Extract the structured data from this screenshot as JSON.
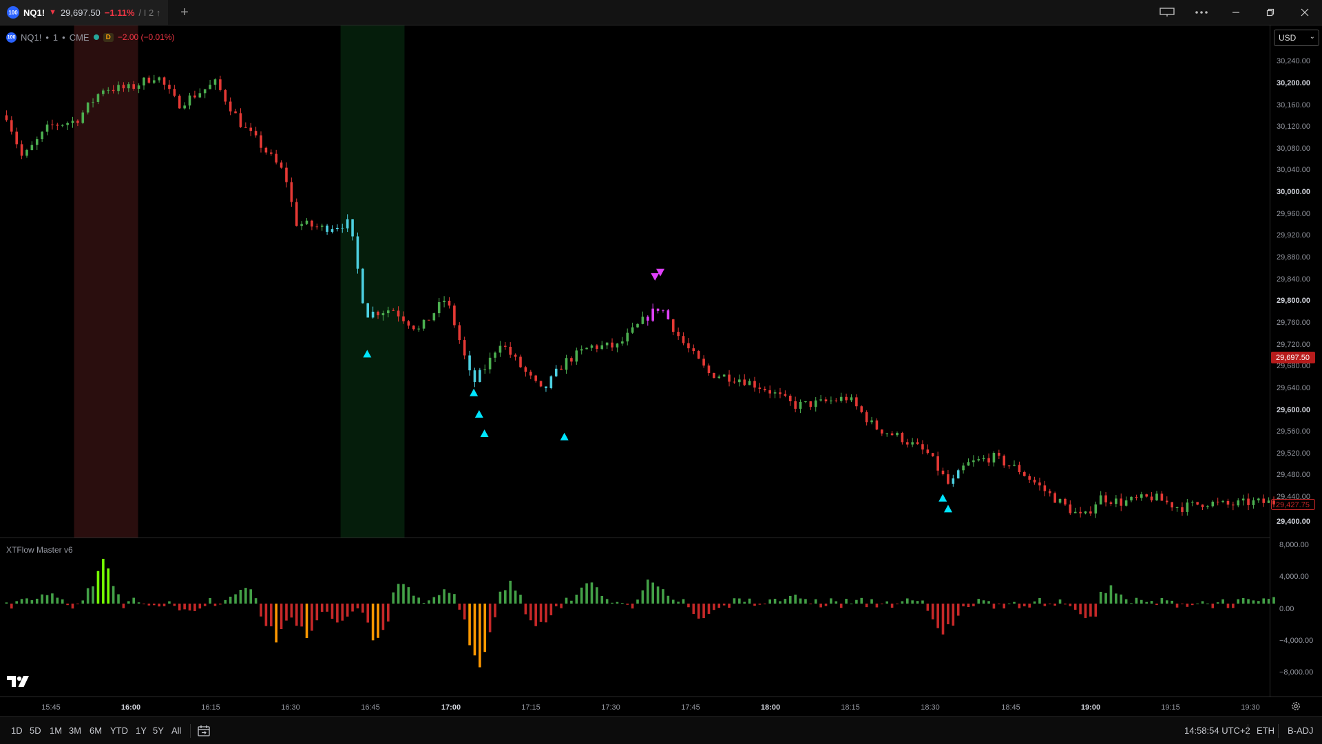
{
  "window": {
    "tab": {
      "badge": "100",
      "symbol": "NQ1!",
      "arrow": "▼",
      "price": "29,697.50",
      "change_pct": "−1.11%",
      "suffix": "/ I 2 ↑"
    },
    "new_tab": "+",
    "controls": [
      "layout-icon",
      "more-icon",
      "minimize-icon",
      "restore-icon",
      "close-icon"
    ]
  },
  "legend": {
    "badge": "100",
    "symbol": "NQ1!",
    "interval": "1",
    "exchange": "CME",
    "session_badge": "D",
    "change": "−2.00 (−0.01%)"
  },
  "currency": "USD",
  "price_axis": {
    "labels": [
      "30,240.00",
      "30,200.00",
      "30,160.00",
      "30,120.00",
      "30,080.00",
      "30,040.00",
      "30,000.00",
      "29,960.00",
      "29,920.00",
      "29,880.00",
      "29,840.00",
      "29,800.00",
      "29,760.00",
      "29,720.00",
      "29,680.00",
      "29,640.00",
      "29,600.00",
      "29,560.00",
      "29,520.00",
      "29,480.00",
      "29,440.00",
      "29,400.00"
    ],
    "last_price": "29,697.50",
    "ghost_price": "29,427.75"
  },
  "indicator": {
    "name": "XTFlow Master v6",
    "axis_labels": [
      "8,000.00",
      "4,000.00",
      "0.00",
      "−4,000.00",
      "−8,000.00"
    ]
  },
  "time_axis": {
    "labels": [
      "15:45",
      "16:00",
      "16:15",
      "16:30",
      "16:45",
      "17:00",
      "17:15",
      "17:30",
      "17:45",
      "18:00",
      "18:15",
      "18:30",
      "18:45",
      "19:00",
      "19:15",
      "19:30"
    ]
  },
  "bottom_bar": {
    "ranges": [
      "1D",
      "5D",
      "1M",
      "3M",
      "6M",
      "YTD",
      "1Y",
      "5Y",
      "All"
    ],
    "clock": "14:58:54 UTC+2",
    "session": "ETH",
    "adjust": "B-ADJ"
  },
  "colors": {
    "up": "#4caf50",
    "down": "#e53935",
    "neutral": "#4dd0e1",
    "signal": "#e040fb",
    "hist_up": "#43a047",
    "hist_up_strong": "#76ff03",
    "hist_down": "#c62828",
    "hist_down_strong": "#ff9800",
    "last_price_tag": "#b71c1c"
  },
  "chart_data": {
    "type": "candlestick",
    "title": "",
    "xlabel": "",
    "ylabel": "",
    "ylim": [
      29380,
      30280
    ],
    "time_range": [
      "15:38",
      "19:40"
    ],
    "bars": 250,
    "anchors": [
      {
        "t": "15:38",
        "p": 30160
      },
      {
        "t": "15:41",
        "p": 30080
      },
      {
        "t": "15:46",
        "p": 30140
      },
      {
        "t": "15:51",
        "p": 30150
      },
      {
        "t": "15:56",
        "p": 30210
      },
      {
        "t": "16:01",
        "p": 30210
      },
      {
        "t": "16:06",
        "p": 30235
      },
      {
        "t": "16:10",
        "p": 30180
      },
      {
        "t": "16:17",
        "p": 30220
      },
      {
        "t": "16:22",
        "p": 30140
      },
      {
        "t": "16:25",
        "p": 30110
      },
      {
        "t": "16:30",
        "p": 30050
      },
      {
        "t": "16:32",
        "p": 29960
      },
      {
        "t": "16:37",
        "p": 29950
      },
      {
        "t": "16:42",
        "p": 29960
      },
      {
        "t": "16:45",
        "p": 29790
      },
      {
        "t": "16:50",
        "p": 29800
      },
      {
        "t": "16:55",
        "p": 29760
      },
      {
        "t": "17:00",
        "p": 29820
      },
      {
        "t": "17:02",
        "p": 29760
      },
      {
        "t": "17:05",
        "p": 29660
      },
      {
        "t": "17:08",
        "p": 29700
      },
      {
        "t": "17:10",
        "p": 29740
      },
      {
        "t": "17:15",
        "p": 29680
      },
      {
        "t": "17:18",
        "p": 29645
      },
      {
        "t": "17:22",
        "p": 29700
      },
      {
        "t": "17:27",
        "p": 29730
      },
      {
        "t": "17:32",
        "p": 29730
      },
      {
        "t": "17:37",
        "p": 29780
      },
      {
        "t": "17:40",
        "p": 29805
      },
      {
        "t": "17:44",
        "p": 29740
      },
      {
        "t": "17:49",
        "p": 29680
      },
      {
        "t": "17:55",
        "p": 29670
      },
      {
        "t": "18:00",
        "p": 29650
      },
      {
        "t": "18:05",
        "p": 29620
      },
      {
        "t": "18:10",
        "p": 29625
      },
      {
        "t": "18:15",
        "p": 29635
      },
      {
        "t": "18:20",
        "p": 29580
      },
      {
        "t": "18:25",
        "p": 29560
      },
      {
        "t": "18:30",
        "p": 29530
      },
      {
        "t": "18:34",
        "p": 29470
      },
      {
        "t": "18:37",
        "p": 29510
      },
      {
        "t": "18:42",
        "p": 29525
      },
      {
        "t": "18:47",
        "p": 29500
      },
      {
        "t": "18:52",
        "p": 29460
      },
      {
        "t": "18:56",
        "p": 29430
      },
      {
        "t": "18:59",
        "p": 29410
      },
      {
        "t": "19:02",
        "p": 29450
      },
      {
        "t": "19:06",
        "p": 29440
      },
      {
        "t": "19:12",
        "p": 29450
      },
      {
        "t": "19:17",
        "p": 29430
      },
      {
        "t": "19:22",
        "p": 29440
      },
      {
        "t": "19:26",
        "p": 29435
      },
      {
        "t": "19:30",
        "p": 29440
      },
      {
        "t": "19:34",
        "p": 29440
      }
    ],
    "sessions": [
      {
        "from": "15:51",
        "to": "16:03",
        "color": "#2a0e0e"
      },
      {
        "from": "16:41",
        "to": "16:53",
        "color": "#051d0b"
      }
    ],
    "signals_up": [
      {
        "t": "16:46",
        "p": 29716
      },
      {
        "t": "17:06",
        "p": 29644
      },
      {
        "t": "17:07",
        "p": 29604
      },
      {
        "t": "17:08",
        "p": 29568
      },
      {
        "t": "17:23",
        "p": 29562
      },
      {
        "t": "18:34",
        "p": 29448
      },
      {
        "t": "18:35",
        "p": 29428
      }
    ],
    "signals_down": [
      {
        "t": "17:40",
        "p": 29860
      },
      {
        "t": "17:41",
        "p": 29868
      }
    ],
    "indicator": {
      "ylim": [
        -10000,
        8000
      ],
      "peaks": [
        {
          "t": "15:46",
          "v": 2000
        },
        {
          "t": "15:56",
          "v": 7000
        },
        {
          "t": "16:12",
          "v": -1500
        },
        {
          "t": "16:22",
          "v": 3000
        },
        {
          "t": "16:28",
          "v": -5500
        },
        {
          "t": "16:34",
          "v": -6000
        },
        {
          "t": "16:40",
          "v": -3000
        },
        {
          "t": "16:47",
          "v": -5500
        },
        {
          "t": "16:52",
          "v": 3500
        },
        {
          "t": "17:00",
          "v": 2500
        },
        {
          "t": "17:06",
          "v": -9500
        },
        {
          "t": "17:12",
          "v": 3000
        },
        {
          "t": "17:17",
          "v": -5000
        },
        {
          "t": "17:27",
          "v": 3500
        },
        {
          "t": "17:39",
          "v": 4500
        },
        {
          "t": "17:48",
          "v": -2500
        },
        {
          "t": "18:05",
          "v": 1500
        },
        {
          "t": "18:33",
          "v": -5000
        },
        {
          "t": "19:00",
          "v": -2500
        },
        {
          "t": "19:04",
          "v": 3000
        },
        {
          "t": "19:34",
          "v": 1000
        }
      ]
    }
  }
}
